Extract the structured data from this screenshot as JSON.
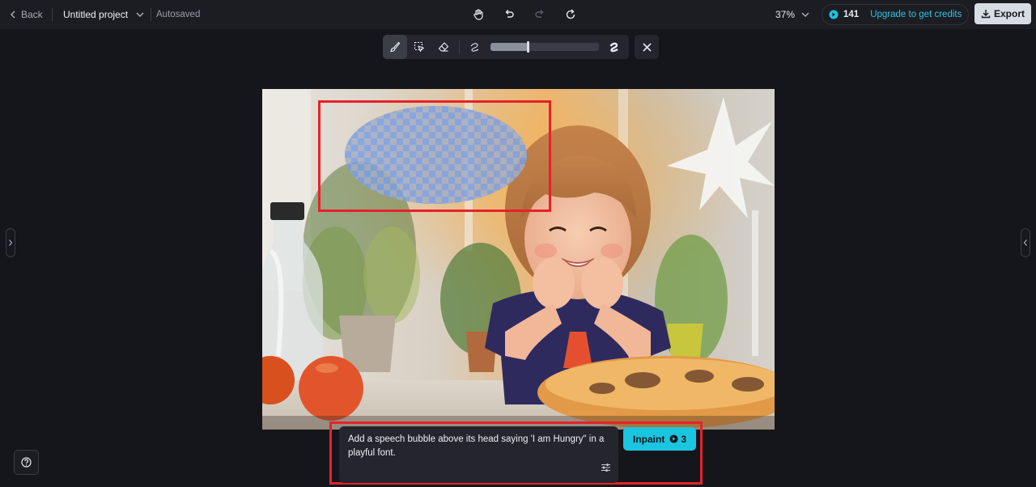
{
  "header": {
    "back_label": "Back",
    "project_name": "Untitled project",
    "autosave_status": "Autosaved",
    "zoom_level": "37%",
    "credits_count": "141",
    "upgrade_label": "Upgrade to get credits",
    "export_label": "Export"
  },
  "toolbar": {
    "tools": [
      "brush-icon",
      "smart-select-icon",
      "eraser-icon"
    ],
    "brush_size_fraction": 0.34
  },
  "prompt": {
    "text": "Add a speech bubble above its head saying 'I am Hungry\" in a playful font.",
    "submit_label": "Inpaint",
    "submit_cost": "3"
  },
  "colors": {
    "accent": "#1bc5e0",
    "selection_outline": "#e5222b",
    "background": "#15161b"
  }
}
